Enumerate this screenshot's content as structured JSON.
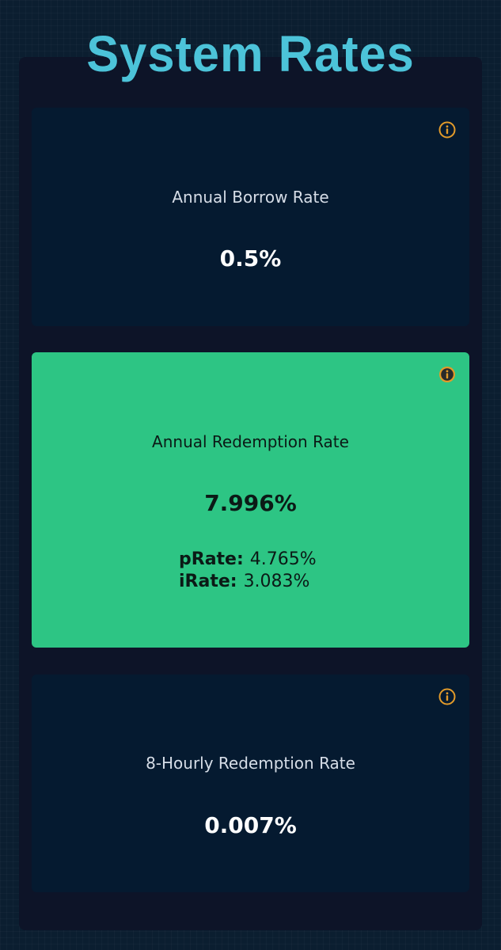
{
  "header": {
    "title": "System Rates"
  },
  "colors": {
    "background": "#0b1e30",
    "panel": "#0d1428",
    "card_dark": "#051a30",
    "card_highlight": "#2dc584",
    "title": "#4cc3d9",
    "info_icon": "#e39b2a"
  },
  "cards": [
    {
      "label": "Annual Borrow Rate",
      "value": "0.5%",
      "icon": "info-icon",
      "highlighted": false
    },
    {
      "label": "Annual Redemption Rate",
      "value": "7.996%",
      "icon": "info-icon",
      "highlighted": true,
      "sub_rates": [
        {
          "name": "pRate:",
          "value": "4.765%"
        },
        {
          "name": "iRate:",
          "value": "3.083%"
        }
      ]
    },
    {
      "label": "8-Hourly Redemption Rate",
      "value": "0.007%",
      "icon": "info-icon",
      "highlighted": false
    }
  ]
}
